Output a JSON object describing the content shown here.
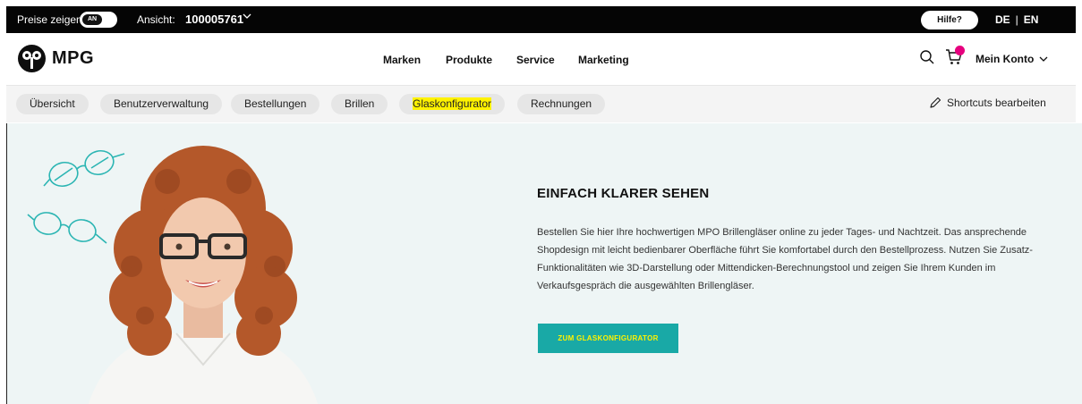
{
  "topbar": {
    "prices_label": "Preise zeigen:",
    "toggle_value": "AN",
    "view_label": "Ansicht:",
    "view_value": "100005761",
    "help_label": "Hilfe?",
    "lang_de": "DE",
    "lang_sep": "|",
    "lang_en": "EN"
  },
  "mainnav": {
    "logo_text": "MPG",
    "items": [
      "Marken",
      "Produkte",
      "Service",
      "Marketing"
    ],
    "account_label": "Mein Konto",
    "search_icon": "search-icon",
    "cart_icon": "cart-icon"
  },
  "shortcuts": {
    "items": [
      "Übersicht",
      "Benutzerverwaltung",
      "Bestellungen",
      "Brillen",
      "Glaskonfigurator",
      "Rechnungen"
    ],
    "active_index": 4,
    "edit_label": "Shortcuts bearbeiten"
  },
  "hero": {
    "title": "EINFACH KLARER SEHEN",
    "text": "Bestellen Sie hier Ihre hochwertigen MPO Brillengläser online zu jeder Tages- und Nachtzeit. Das ansprechende Shopdesign mit leicht bedienbarer Oberfläche führt Sie komfortabel durch den Bestellprozess. Nutzen Sie Zusatz-Funktionalitäten wie 3D-Darstellung oder Mittendicken-Berechnungstool und zeigen Sie Ihrem Kunden im Verkaufsgespräch die ausgewählten Brillengläser.",
    "cta_label": "ZUM GLASKONFIGURATOR"
  },
  "colors": {
    "topbar_bg": "#050505",
    "hero_bg": "#eef5f5",
    "cta_bg": "#19a9a6",
    "highlight": "#fff200",
    "badge": "#e6007e",
    "deco_glasses": "#2bb5b3"
  }
}
